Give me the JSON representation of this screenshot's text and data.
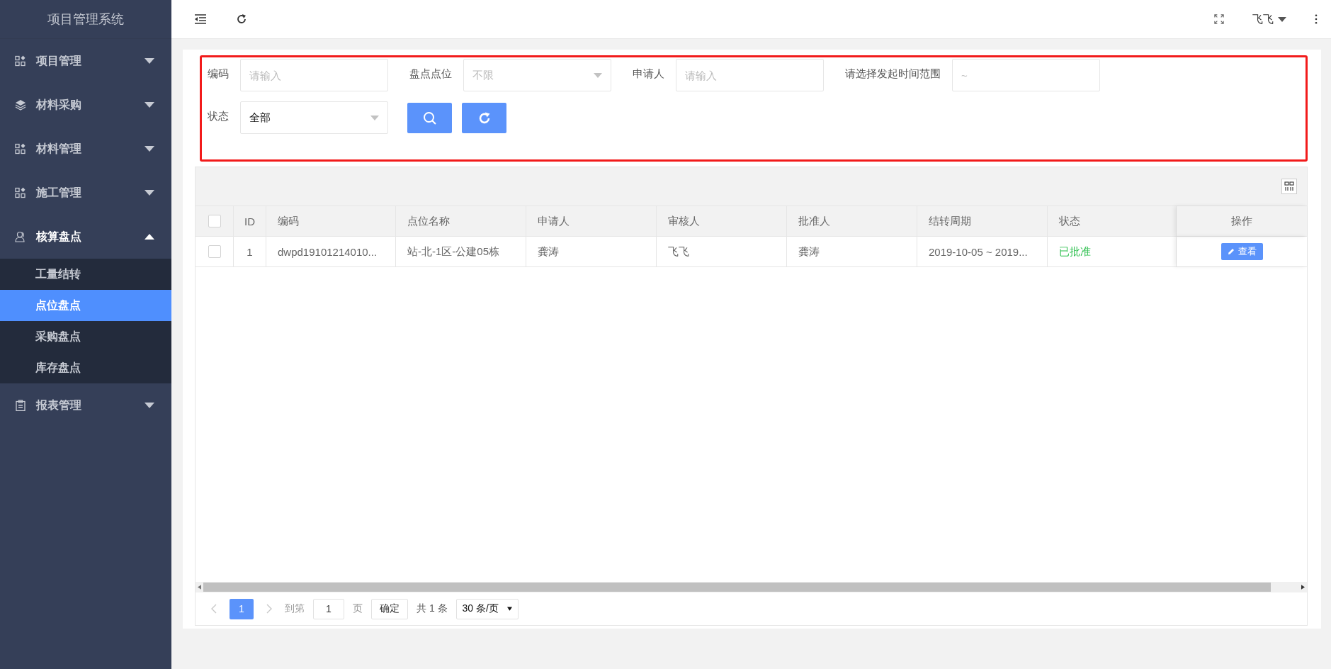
{
  "app_title": "项目管理系统",
  "sidebar": {
    "items": [
      {
        "label": "项目管理",
        "kind": "grid",
        "expanded": false
      },
      {
        "label": "材料采购",
        "kind": "layers",
        "expanded": false
      },
      {
        "label": "材料管理",
        "kind": "grid",
        "expanded": false
      },
      {
        "label": "施工管理",
        "kind": "grid",
        "expanded": false
      },
      {
        "label": "核算盘点",
        "kind": "user",
        "expanded": true,
        "children": [
          {
            "label": "工量结转",
            "selected": false
          },
          {
            "label": "点位盘点",
            "selected": true
          },
          {
            "label": "采购盘点",
            "selected": false
          },
          {
            "label": "库存盘点",
            "selected": false
          }
        ]
      },
      {
        "label": "报表管理",
        "kind": "clipboard",
        "expanded": false
      }
    ]
  },
  "header": {
    "user_name": "飞飞"
  },
  "filters": [
    [
      {
        "label": "编码",
        "kind": "input",
        "placeholder": "请输入"
      },
      {
        "label": "盘点点位",
        "kind": "select",
        "placeholder": "不限"
      },
      {
        "label": "申请人",
        "kind": "input",
        "placeholder": "请输入"
      },
      {
        "label": "请选择发起时间范围",
        "kind": "input",
        "placeholder": "~"
      }
    ],
    [
      {
        "label": "状态",
        "kind": "select",
        "value": "全部"
      }
    ]
  ],
  "table": {
    "header_checked": false,
    "columns": [
      "ID",
      "编码",
      "点位名称",
      "申请人",
      "审核人",
      "批准人",
      "结转周期",
      "状态",
      "操作"
    ],
    "rows": [
      {
        "checked": false,
        "cells": [
          {
            "kind": "center",
            "text": "1"
          },
          {
            "kind": "text",
            "text": "dwpd19101214010..."
          },
          {
            "kind": "text",
            "text": "站-北-1区-公建05栋"
          },
          {
            "kind": "text",
            "text": "龚涛"
          },
          {
            "kind": "text",
            "text": "飞飞"
          },
          {
            "kind": "text",
            "text": "龚涛"
          },
          {
            "kind": "text",
            "text": "2019-10-05 ~ 2019..."
          },
          {
            "kind": "status",
            "text": "已批准"
          },
          {
            "kind": "button",
            "text": "查看"
          }
        ]
      }
    ]
  },
  "pagination": {
    "prev_disabled": true,
    "next_disabled": true,
    "pages": [
      {
        "label": "1",
        "selected": true
      }
    ],
    "goto_label": "到第",
    "goto_value": "1",
    "page_unit": "页",
    "confirm": "确定",
    "total": "共 1 条",
    "page_size": "30 条/页"
  }
}
